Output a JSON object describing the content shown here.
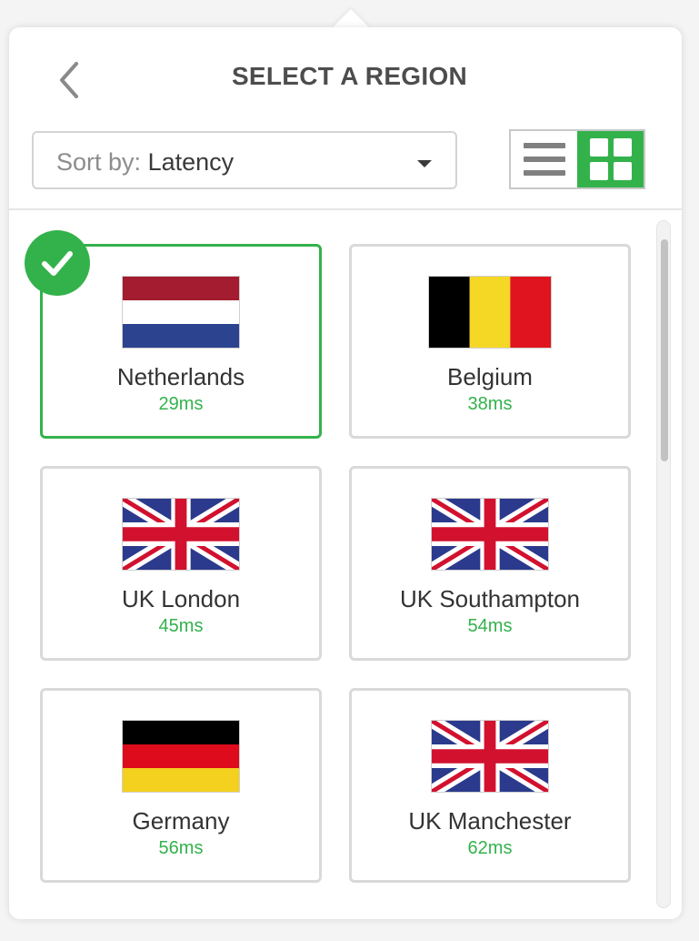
{
  "header": {
    "title": "SELECT A REGION",
    "back_icon": "chevron-left-icon"
  },
  "sort": {
    "prefix": "Sort by:",
    "value": "Latency",
    "caret_icon": "caret-down-icon"
  },
  "view_toggle": {
    "active": "grid",
    "list_icon": "list-icon",
    "grid_icon": "grid-icon"
  },
  "colors": {
    "accent": "#33b24c",
    "title": "#4d4d4d",
    "card_border": "#d9d9d9"
  },
  "regions": [
    {
      "name": "Netherlands",
      "latency": "29ms",
      "flag": "netherlands-flag",
      "selected": true
    },
    {
      "name": "Belgium",
      "latency": "38ms",
      "flag": "belgium-flag",
      "selected": false
    },
    {
      "name": "UK London",
      "latency": "45ms",
      "flag": "uk-flag",
      "selected": false
    },
    {
      "name": "UK Southampton",
      "latency": "54ms",
      "flag": "uk-flag",
      "selected": false
    },
    {
      "name": "Germany",
      "latency": "56ms",
      "flag": "germany-flag",
      "selected": false
    },
    {
      "name": "UK Manchester",
      "latency": "62ms",
      "flag": "uk-flag",
      "selected": false
    }
  ]
}
